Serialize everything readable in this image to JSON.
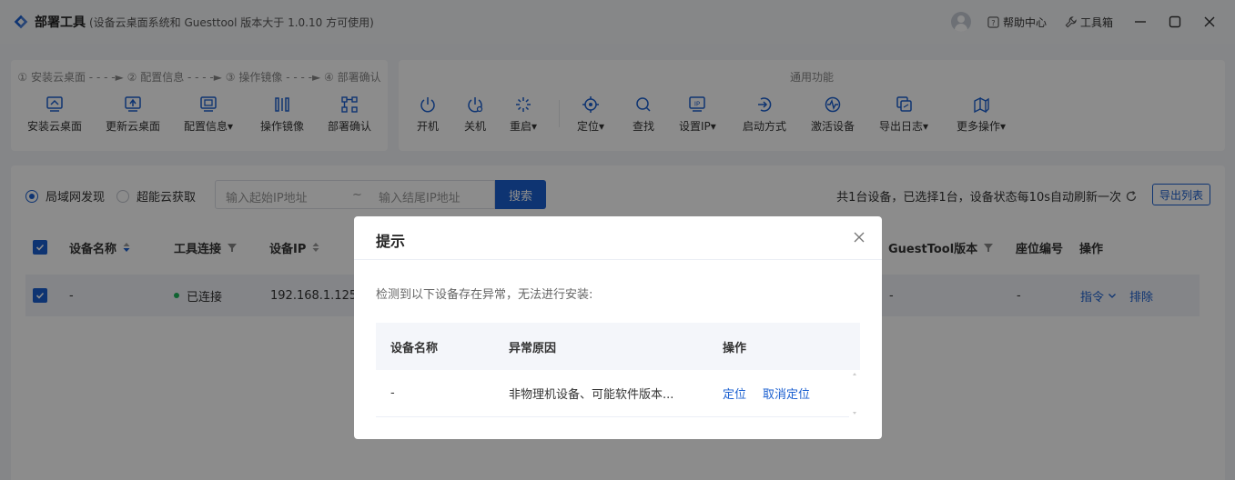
{
  "titlebar": {
    "app_title": "部署工具",
    "app_subtitle": "(设备云桌面系统和 Guesttool 版本大于 1.0.10 方可使用)",
    "help_label": "帮助中心",
    "toolbox_label": "工具箱"
  },
  "deploy_panel": {
    "steps_text": "① 安装云桌面 - - - -► ② 配置信息 - - - -► ③ 操作镜像 - - - -► ④ 部署确认",
    "tools": [
      {
        "label": "安装云桌面",
        "icon": "install-desktop-icon"
      },
      {
        "label": "更新云桌面",
        "icon": "update-desktop-icon"
      },
      {
        "label": "配置信息▾",
        "icon": "config-info-icon"
      },
      {
        "label": "操作镜像",
        "icon": "image-operation-icon"
      },
      {
        "label": "部署确认",
        "icon": "deploy-confirm-icon"
      }
    ]
  },
  "common_panel": {
    "title": "通用功能",
    "tools": [
      {
        "label": "开机",
        "icon": "power-on-icon"
      },
      {
        "label": "关机",
        "icon": "power-off-icon"
      },
      {
        "label": "重启▾",
        "icon": "restart-icon"
      },
      {
        "label": "定位▾",
        "icon": "locate-icon"
      },
      {
        "label": "查找",
        "icon": "search-icon"
      },
      {
        "label": "设置IP▾",
        "icon": "set-ip-icon"
      },
      {
        "label": "启动方式",
        "icon": "boot-mode-icon"
      },
      {
        "label": "激活设备",
        "icon": "activate-icon"
      },
      {
        "label": "导出日志▾",
        "icon": "export-log-icon"
      },
      {
        "label": "更多操作▾",
        "icon": "more-actions-icon"
      }
    ]
  },
  "filters": {
    "radio_lan": "局域网发现",
    "radio_cloud": "超能云获取",
    "ip_start_placeholder": "输入起始IP地址",
    "ip_separator": "~",
    "ip_end_placeholder": "输入结尾IP地址",
    "search_label": "搜索",
    "summary": "共1台设备，已选择1台，设备状态每10s自动刷新一次",
    "export_label": "导出列表"
  },
  "table": {
    "headers": {
      "device_name": "设备名称",
      "tool_connection": "工具连接",
      "device_ip": "设备IP",
      "guesttool_version": "GuestTool版本",
      "seat_number": "座位编号",
      "operation": "操作"
    },
    "row": {
      "device_name": "-",
      "tool_connection": "已连接",
      "device_ip": "192.168.1.125",
      "guesttool_version": "-",
      "seat_number": "-",
      "action_command": "指令",
      "action_remove": "排除"
    }
  },
  "modal": {
    "title": "提示",
    "message": "检测到以下设备存在异常，无法进行安装:",
    "headers": {
      "device_name": "设备名称",
      "reason": "异常原因",
      "operation": "操作"
    },
    "row": {
      "device_name": "-",
      "reason": "非物理机设备、可能软件版本...",
      "locate": "定位",
      "cancel_locate": "取消定位"
    }
  },
  "colors": {
    "accent": "#1a5fd0",
    "connected": "#1db45a"
  }
}
